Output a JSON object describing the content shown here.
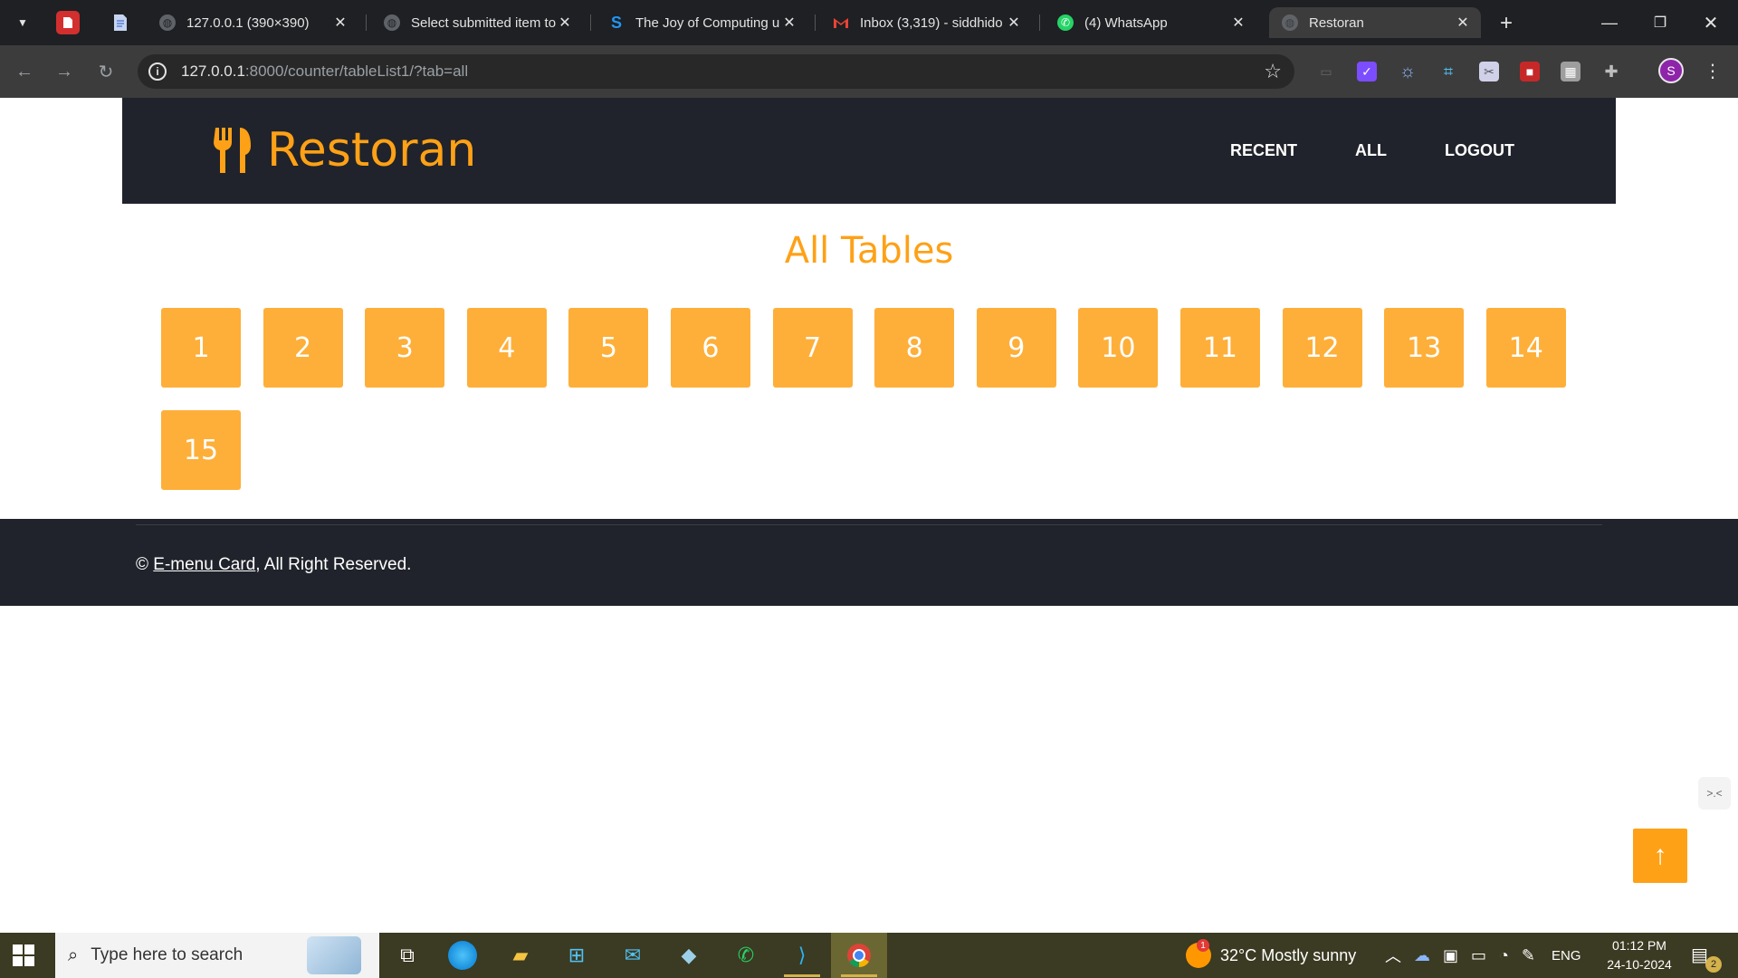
{
  "browser": {
    "tabs": [
      {
        "title": "127.0.0.1 (390×390)",
        "active": false
      },
      {
        "title": "Select submitted item to",
        "active": false
      },
      {
        "title": "The Joy of Computing u",
        "active": false
      },
      {
        "title": "Inbox (3,319) - siddhido",
        "active": false
      },
      {
        "title": "(4) WhatsApp",
        "active": false
      },
      {
        "title": "Restoran",
        "active": true
      }
    ],
    "url_host": "127.0.0.1",
    "url_rest": ":8000/counter/tableList1/?tab=all",
    "profile_initial": "S"
  },
  "site": {
    "brand": "Restoran",
    "nav": [
      "RECENT",
      "ALL",
      "LOGOUT"
    ],
    "page_title": "All Tables",
    "tables": [
      "1",
      "2",
      "3",
      "4",
      "5",
      "6",
      "7",
      "8",
      "9",
      "10",
      "11",
      "12",
      "13",
      "14",
      "15"
    ],
    "footer": {
      "copyright_symbol": "©",
      "link_text": "E-menu Card",
      "rest": ", All Right Reserved."
    },
    "colors": {
      "accent": "#fea116",
      "tile": "#feaf39",
      "dark": "#20232b"
    }
  },
  "taskbar": {
    "search_placeholder": "Type here to search",
    "weather": "32°C  Mostly sunny",
    "language": "ENG",
    "time": "01:12 PM",
    "date": "24-10-2024",
    "notification_count": "2",
    "weather_badge": "1"
  }
}
